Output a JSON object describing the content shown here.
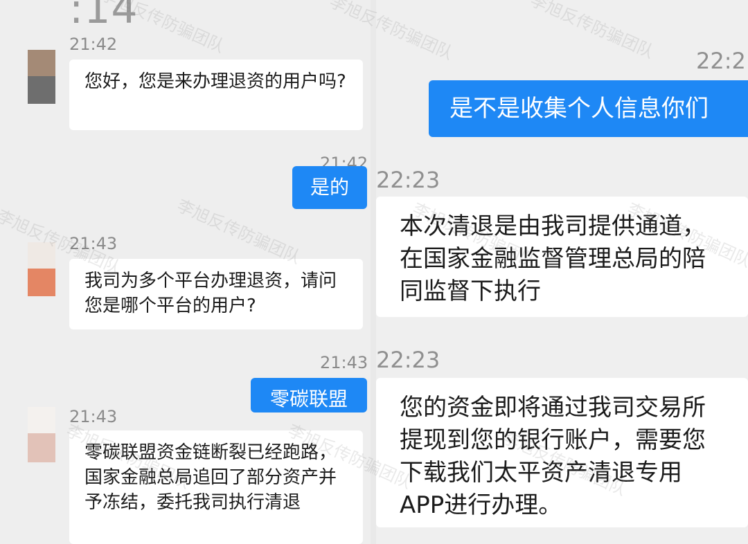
{
  "left": {
    "clock_partial": ":14",
    "messages": [
      {
        "time": "21:42",
        "text": "您好，您是来办理退资的用户吗?"
      },
      {
        "time": "21:42",
        "text": "是的"
      },
      {
        "time": "21:43",
        "text": "我司为多个平台办理退资，请问您是哪个平台的用户?"
      },
      {
        "time": "21:43",
        "text": "零碳联盟"
      },
      {
        "time": "21:43",
        "text": "零碳联盟资金链断裂已经跑路，国家金融总局追回了部分资产并予冻结，委托我司执行清退"
      }
    ]
  },
  "right": {
    "messages": [
      {
        "time": "22:2",
        "text": "是不是收集个人信息你们"
      },
      {
        "time": "22:23",
        "text": "本次清退是由我司提供通道，在国家金融监督管理总局的陪同监督下执行"
      },
      {
        "time": "22:23",
        "text": "您的资金即将通过我司交易所提现到您的银行账户，需要您下载我们太平资产清退专用APP进行办理。"
      }
    ]
  },
  "watermark_text": "李旭反传防骗团队",
  "colors": {
    "outgoing_bubble": "#1e88f5",
    "incoming_bubble": "#ffffff",
    "background": "#eeeeee"
  }
}
